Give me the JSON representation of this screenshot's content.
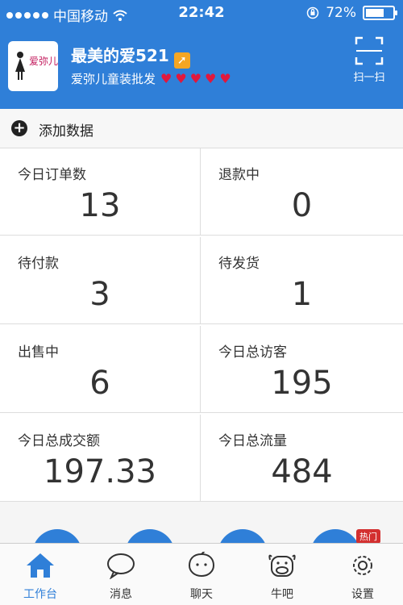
{
  "status": {
    "carrier": "中国移动",
    "time": "22:42",
    "battery": "72%"
  },
  "header": {
    "title": "最美的爱521",
    "subtitle": "爱弥儿童装批发",
    "avatar_text": "爱弥儿",
    "scan_label": "扫一扫"
  },
  "add_data": "添加数据",
  "stats": [
    {
      "label": "今日订单数",
      "value": "13"
    },
    {
      "label": "退款中",
      "value": "0"
    },
    {
      "label": "待付款",
      "value": "3"
    },
    {
      "label": "待发货",
      "value": "1"
    },
    {
      "label": "出售中",
      "value": "6"
    },
    {
      "label": "今日总访客",
      "value": "195"
    },
    {
      "label": "今日总成交额",
      "value": "197.33"
    },
    {
      "label": "今日总流量",
      "value": "484"
    }
  ],
  "hot_badge": "热门",
  "tabs": [
    {
      "label": "工作台",
      "icon": "home-icon"
    },
    {
      "label": "消息",
      "icon": "chat-bubble-icon"
    },
    {
      "label": "聊天",
      "icon": "talk-icon"
    },
    {
      "label": "牛吧",
      "icon": "cow-icon"
    },
    {
      "label": "设置",
      "icon": "gear-icon"
    }
  ],
  "accent_color": "#2f7fd8"
}
